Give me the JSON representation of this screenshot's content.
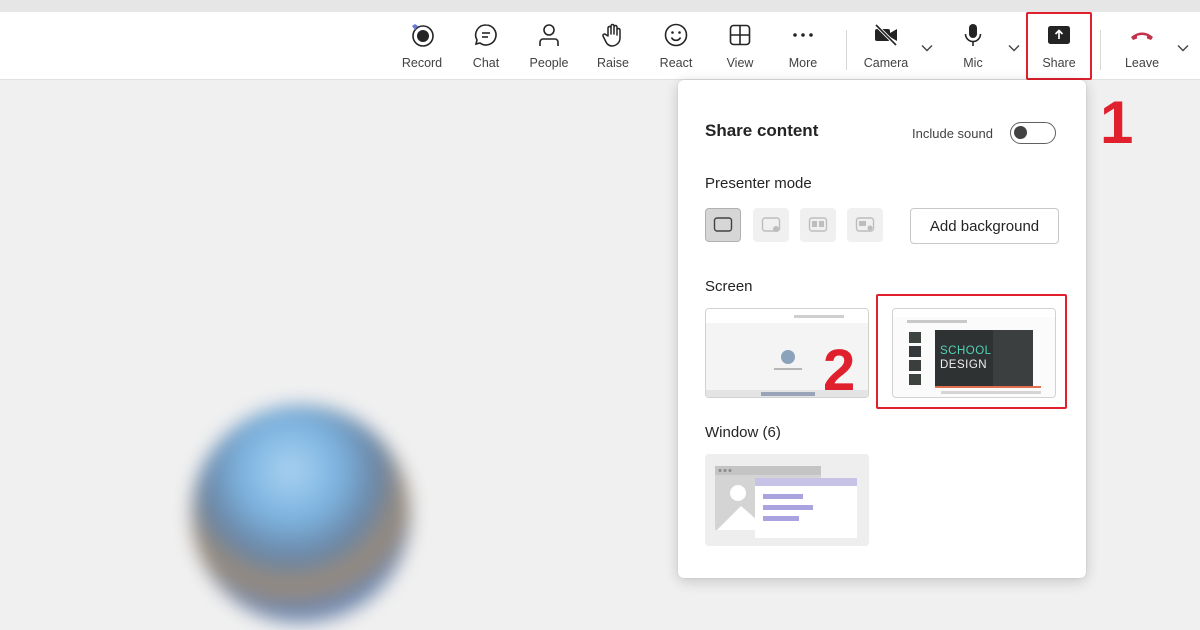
{
  "toolbar": {
    "items": [
      {
        "id": "record",
        "label": "Record",
        "icon": "record-icon"
      },
      {
        "id": "chat",
        "label": "Chat",
        "icon": "chat-icon"
      },
      {
        "id": "people",
        "label": "People",
        "icon": "people-icon"
      },
      {
        "id": "raise",
        "label": "Raise",
        "icon": "hand-icon"
      },
      {
        "id": "react",
        "label": "React",
        "icon": "smiley-icon"
      },
      {
        "id": "view",
        "label": "View",
        "icon": "grid-icon"
      },
      {
        "id": "more",
        "label": "More",
        "icon": "ellipsis-icon"
      },
      {
        "id": "camera",
        "label": "Camera",
        "icon": "camera-off-icon"
      },
      {
        "id": "mic",
        "label": "Mic",
        "icon": "mic-icon"
      },
      {
        "id": "share",
        "label": "Share",
        "icon": "share-icon"
      },
      {
        "id": "leave",
        "label": "Leave",
        "icon": "phone-hangup-icon"
      }
    ]
  },
  "share_panel": {
    "title": "Share content",
    "include_sound_label": "Include sound",
    "include_sound_on": false,
    "presenter_mode_label": "Presenter mode",
    "presenter_modes": [
      "content-only-icon",
      "standout-icon",
      "side-by-side-icon",
      "reporter-icon"
    ],
    "add_background_label": "Add background",
    "screen_label": "Screen",
    "screens": [
      {
        "id": "screen-1",
        "description": "desktop-with-meeting"
      },
      {
        "id": "screen-2",
        "slide_line1": "SCHOOL",
        "slide_line2": "DESIGN"
      }
    ],
    "window_label": "Window (6)"
  },
  "annotations": {
    "step1": "1",
    "step2": "2",
    "color": "#e0202c"
  },
  "colors": {
    "toolbar_bg": "#ffffff",
    "stage_bg": "#f0f0f0",
    "accent_red": "#c4314b"
  }
}
